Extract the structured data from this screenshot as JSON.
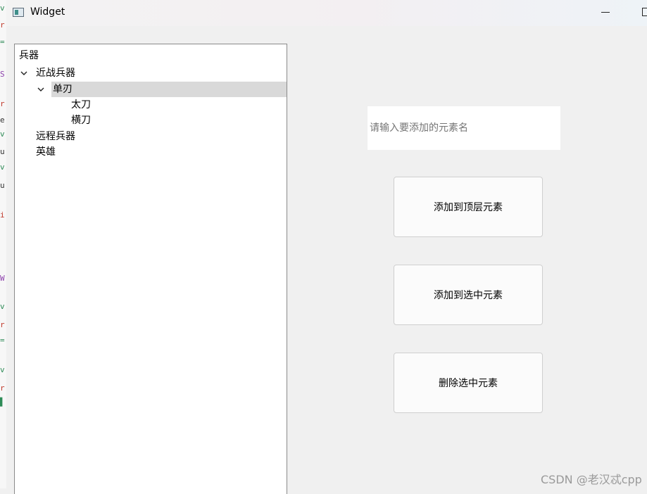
{
  "window": {
    "title": "Widget",
    "icon": "qt-widget-app-icon"
  },
  "tree": {
    "header": "兵器",
    "items": [
      {
        "label": "近战兵器",
        "expanded": true,
        "selected": false
      },
      {
        "label": "单刃",
        "expanded": true,
        "selected": true
      },
      {
        "label": "太刀",
        "selected": false
      },
      {
        "label": "横刀",
        "selected": false
      },
      {
        "label": "远程兵器",
        "selected": false
      },
      {
        "label": "英雄",
        "selected": false
      }
    ]
  },
  "input": {
    "value": "",
    "placeholder": "请输入要添加的元素名"
  },
  "buttons": {
    "add_top": "添加到顶层元素",
    "add_selected": "添加到选中元素",
    "delete_selected": "删除选中元素"
  },
  "watermark": "CSDN @老汉忒cpp",
  "colors": {
    "selection": "#d9d9d9",
    "window_bg": "#f0f0f0"
  }
}
